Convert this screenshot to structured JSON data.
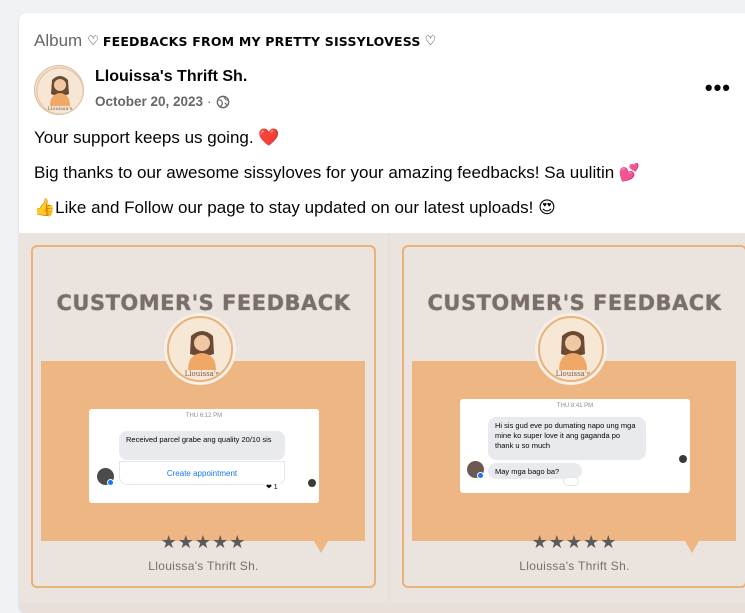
{
  "album": {
    "label": "Album",
    "heart": "♡",
    "title": "FEEDBACKS FROM MY PRETTY SISSYLOVESS",
    "heart_end": "♡"
  },
  "post": {
    "page_name": "Llouissa's Thrift Sh.",
    "date": "October 20, 2023",
    "separator": "·",
    "audience_icon": "globe-icon",
    "more_label": "•••",
    "lines": [
      {
        "text": "Your support keeps us going. ",
        "emoji": "❤️"
      },
      {
        "text": "Big thanks to our awesome sissyloves for your amazing feedbacks! Sa uulitin ",
        "emoji": "💕"
      },
      {
        "emoji_lead": "👍",
        "text": "Like and Follow our page to stay updated on our latest uploads! ",
        "emoji": "😍"
      }
    ]
  },
  "photos": [
    {
      "heading": "CUSTOMER'S FEEDBACK",
      "chat_time": "THU 6:12 PM",
      "message": "Received parcel grabe ang quality 20/10 sis",
      "action": "Create appointment",
      "reaction": "❤ 1",
      "rating": "★★★★★",
      "brand": "Llouissa's Thrift Sh."
    },
    {
      "heading": "CUSTOMER'S FEEDBACK",
      "chat_time": "THU 8:41 PM",
      "message": "Hi sis gud eve po dumating napo ung mga mine ko super love it ang gaganda po thank u so much",
      "message2": "May mga bago ba?",
      "rating": "★★★★★",
      "brand": "Llouissa's Thrift Sh."
    }
  ],
  "colors": {
    "accent_orange": "#edb682",
    "frame_orange": "#e8b27a",
    "text_secondary": "#65676b",
    "link_blue": "#1877f2"
  }
}
